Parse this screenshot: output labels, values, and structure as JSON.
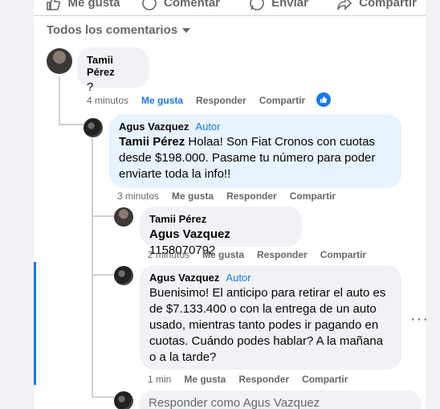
{
  "actions": [
    "Me gusta",
    "Comentar",
    "Enviar",
    "Compartir"
  ],
  "filter_label": "Todos los comentarios",
  "comments": [
    {
      "author": "Tamii Pérez",
      "text": "?",
      "time": "4 minutos",
      "like": "Me gusta",
      "reply": "Responder",
      "share": "Compartir"
    },
    {
      "author": "Agus Vazquez",
      "tag": "Autor",
      "mention": "Tamii Pérez",
      "text": " Holaa! Son Fiat Cronos con cuotas desde $198.000. Pasame tu número para poder enviarte toda la info!!",
      "time": "3 minutos",
      "like": "Me gusta",
      "reply": "Responder",
      "share": "Compartir"
    },
    {
      "author": "Tamii Pérez",
      "mention": "Agus Vazquez",
      "text": " 1158070792",
      "time": "2 minutos",
      "like": "Me gusta",
      "reply": "Responder",
      "share": "Compartir"
    },
    {
      "author": "Agus Vazquez",
      "tag": "Autor",
      "text": "Buenisimo! El anticipo para retirar el auto es de $7.133.400 o con la entrega de un auto usado, mientras tanto podes ir pagando en cuotas. Cuándo podes hablar? A la mañana o a la tarde?",
      "time": "1 min",
      "like": "Me gusta",
      "reply": "Responder",
      "share": "Compartir"
    }
  ],
  "reply_placeholder": "Responder como Agus Vazquez",
  "more_options": "···"
}
